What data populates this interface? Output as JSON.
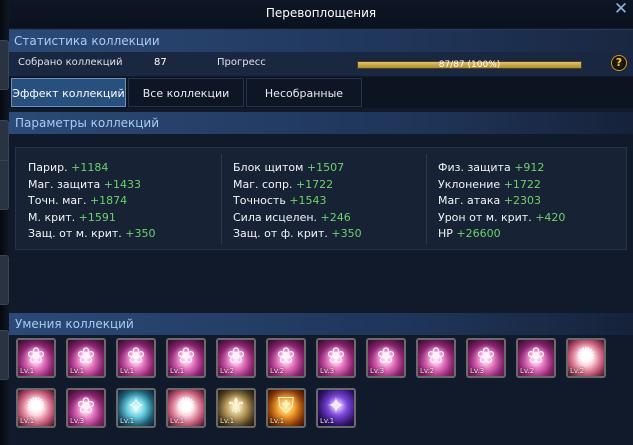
{
  "window": {
    "title": "Перевоплощения"
  },
  "stats": {
    "title": "Статистика коллекции",
    "collected_label": "Собрано коллекций",
    "collected_value": "87",
    "progress_label": "Прогресс",
    "progress_text": "87/87 (100%)",
    "progress_fraction": 1.0
  },
  "tabs": [
    {
      "label": "Эффект коллекций",
      "active": true
    },
    {
      "label": "Все коллекции",
      "active": false
    },
    {
      "label": "Несобранные",
      "active": false
    }
  ],
  "params": {
    "title": "Параметры коллекций",
    "columns": [
      [
        {
          "name": "Парир.",
          "bonus": "+1184"
        },
        {
          "name": "Маг. защита",
          "bonus": "+1433"
        },
        {
          "name": "Точн. маг.",
          "bonus": "+1874"
        },
        {
          "name": "М. крит.",
          "bonus": "+1591"
        },
        {
          "name": "Защ. от м. крит.",
          "bonus": "+350"
        }
      ],
      [
        {
          "name": "Блок щитом",
          "bonus": "+1507"
        },
        {
          "name": "Маг. сопр.",
          "bonus": "+1722"
        },
        {
          "name": "Точность",
          "bonus": "+1543"
        },
        {
          "name": "Сила исцелен.",
          "bonus": "+246"
        },
        {
          "name": "Защ. от ф. крит.",
          "bonus": "+350"
        }
      ],
      [
        {
          "name": "Физ. защита",
          "bonus": "+912"
        },
        {
          "name": "Уклонение",
          "bonus": "+1722"
        },
        {
          "name": "Маг. атака",
          "bonus": "+2303"
        },
        {
          "name": "Урон от м. крит.",
          "bonus": "+420"
        },
        {
          "name": "HP",
          "bonus": "+26600"
        }
      ]
    ]
  },
  "skills": {
    "title": "Умения коллекций",
    "rows": [
      [
        {
          "icon": "pink-lotus-icon",
          "level": "Lv.1"
        },
        {
          "icon": "pink-lotus-icon",
          "level": "Lv.1"
        },
        {
          "icon": "pink-lotus-icon",
          "level": "Lv.1"
        },
        {
          "icon": "pink-lotus-icon",
          "level": "Lv.1"
        },
        {
          "icon": "pink-lotus-icon",
          "level": "Lv.2"
        },
        {
          "icon": "pink-lotus-icon",
          "level": "Lv.2"
        },
        {
          "icon": "pink-lotus-icon",
          "level": "Lv.3"
        },
        {
          "icon": "pink-lotus-icon",
          "level": "Lv.3"
        },
        {
          "icon": "pink-lotus-icon",
          "level": "Lv.2"
        },
        {
          "icon": "pink-lotus-icon",
          "level": "Lv.3"
        },
        {
          "icon": "pink-lotus-icon",
          "level": "Lv.2"
        },
        {
          "icon": "bright-burst-icon",
          "level": "Lv.2"
        }
      ],
      [
        {
          "icon": "bright-burst-icon",
          "level": "Lv.1"
        },
        {
          "icon": "pink-lotus-icon",
          "level": "Lv.3"
        },
        {
          "icon": "cyan-crystal-icon",
          "level": "Lv.1"
        },
        {
          "icon": "bright-burst-icon",
          "level": "Lv.1"
        },
        {
          "icon": "golden-wings-icon",
          "level": "Lv.1"
        },
        {
          "icon": "fire-shield-icon",
          "level": "Lv.1"
        },
        {
          "icon": "violet-figure-icon",
          "level": "Lv.1"
        }
      ]
    ]
  },
  "colors": {
    "accent": "#27507f",
    "bonus_green": "#6ed16e",
    "progress_gold": "#d4b04a",
    "header_text": "#a8cdf2"
  }
}
